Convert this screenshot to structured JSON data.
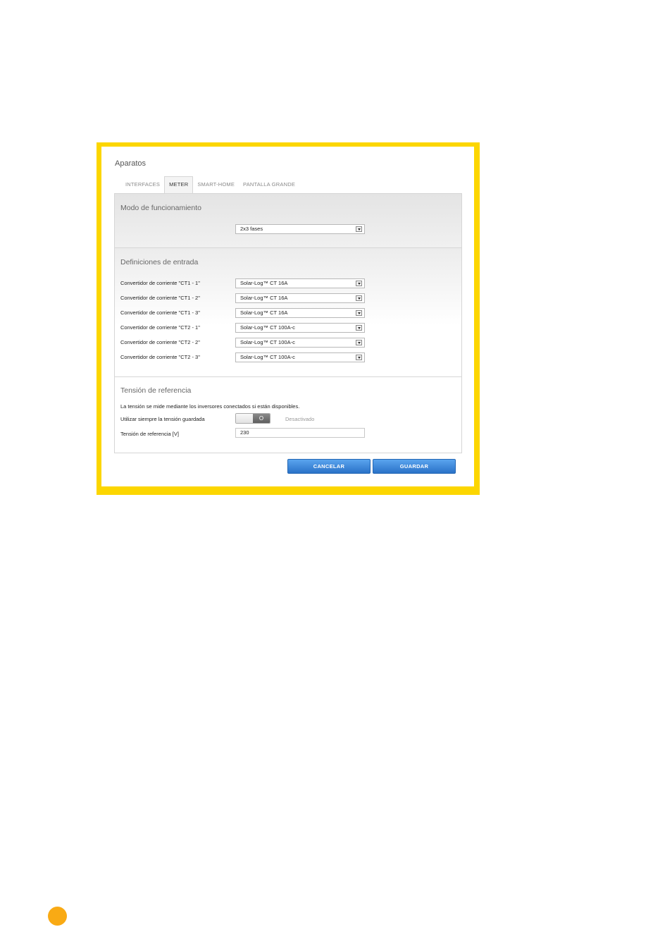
{
  "window": {
    "title": "Aparatos"
  },
  "tabs": [
    {
      "label": "INTERFACES",
      "active": false
    },
    {
      "label": "METER",
      "active": true
    },
    {
      "label": "SMART-HOME",
      "active": false
    },
    {
      "label": "PANTALLA GRANDE",
      "active": false
    }
  ],
  "mode": {
    "title": "Modo de funcionamiento",
    "selected": "2x3 fases"
  },
  "inputs": {
    "title": "Definiciones de entrada",
    "rows": [
      {
        "label": "Convertidor de corriente \"CT1 - 1\"",
        "value": "Solar-Log™ CT 16A"
      },
      {
        "label": "Convertidor de corriente \"CT1 - 2\"",
        "value": "Solar-Log™ CT 16A"
      },
      {
        "label": "Convertidor de corriente \"CT1 - 3\"",
        "value": "Solar-Log™ CT 16A"
      },
      {
        "label": "Convertidor de corriente \"CT2 - 1\"",
        "value": "Solar-Log™ CT 100A-c"
      },
      {
        "label": "Convertidor de corriente \"CT2 - 2\"",
        "value": "Solar-Log™ CT 100A-c"
      },
      {
        "label": "Convertidor de corriente \"CT2 - 3\"",
        "value": "Solar-Log™ CT 100A-c"
      }
    ]
  },
  "reference": {
    "title": "Tensión de referencia",
    "info": "La tensión se mide mediante los inversores conectados si están disponibles.",
    "toggle_label": "Utilizar siempre la tensión guardada",
    "toggle_knob": "O",
    "toggle_state": "Desactivado",
    "voltage_label": "Tensión de referencia [V]",
    "voltage_value": "230"
  },
  "buttons": {
    "cancel": "CANCELAR",
    "save": "GUARDAR"
  },
  "colors": {
    "frame": "#fcd600",
    "button": "#2a72c8",
    "page_dot": "#f9aa14"
  }
}
